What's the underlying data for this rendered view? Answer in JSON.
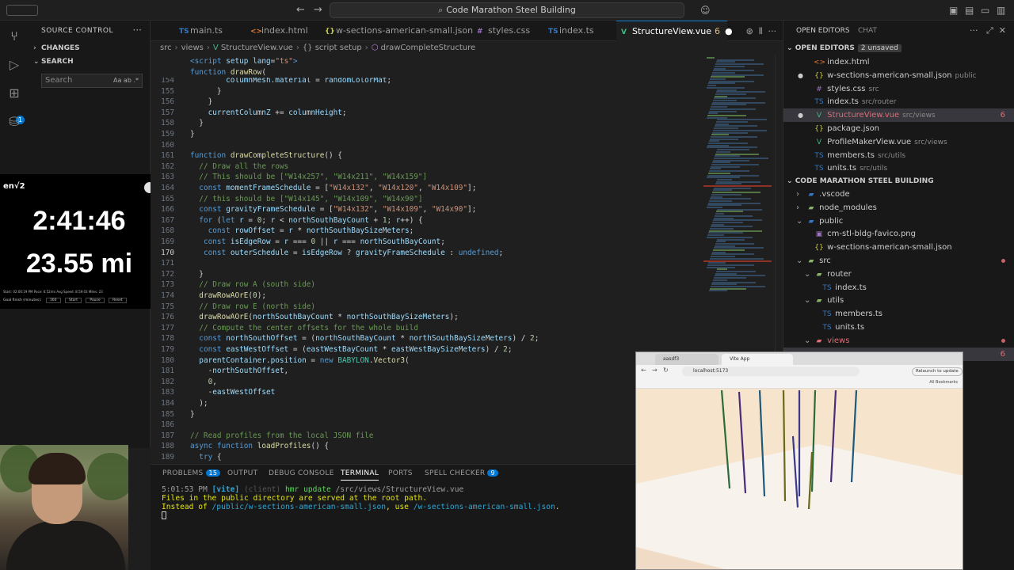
{
  "titlebar": {
    "command_center": "Code Marathon Steel Building"
  },
  "sidebar": {
    "header": "SOURCE CONTROL",
    "changes_label": "CHANGES",
    "search_label": "SEARCH",
    "search_placeholder": "Search",
    "search_opts": "Aa  ab  .*",
    "extensions_badge": "1"
  },
  "overlay": {
    "logo": "en√2",
    "elapsed": "2:41:46",
    "distance": "23.55 mi",
    "stats": "Start: 02:00:19 PM    Pace: 6:52/mi    Avg Speed: 8:59:03    Miles: 23",
    "goal_label": "Goal finish (minutes):",
    "goal_value": "160",
    "goal_buttons": [
      "Start",
      "Pause",
      "Reset"
    ]
  },
  "tabs": [
    {
      "label": "main.ts",
      "icon": "TS",
      "color": "#3178c6"
    },
    {
      "label": "index.html",
      "icon": "<>",
      "color": "#e37933"
    },
    {
      "label": "w-sections-american-small.json",
      "icon": "{}",
      "color": "#cbcb41"
    },
    {
      "label": "styles.css",
      "icon": "#",
      "color": "#a074c4"
    },
    {
      "label": "index.ts",
      "icon": "TS",
      "color": "#3178c6"
    },
    {
      "label": "StructureView.vue",
      "icon": "V",
      "color": "#41b883",
      "problems": "6",
      "active": true
    }
  ],
  "breadcrumb": [
    "src",
    "views",
    "StructureView.vue",
    "{} script setup",
    "drawCompleteStructure"
  ],
  "editor": {
    "sticky": [
      {
        "ln": "",
        "code": "<script setup lang=\"ts\">"
      },
      {
        "ln": "",
        "code": "function drawRow("
      }
    ],
    "lines": [
      {
        "ln": "154",
        "code": "        columnMesh.material = randomColorMat;"
      },
      {
        "ln": "155",
        "code": "      }"
      },
      {
        "ln": "156",
        "code": "    }"
      },
      {
        "ln": "157",
        "code": "    currentColumnZ += columnHeight;"
      },
      {
        "ln": "158",
        "code": "  }"
      },
      {
        "ln": "159",
        "code": "}"
      },
      {
        "ln": "160",
        "code": ""
      },
      {
        "ln": "161",
        "code": "function drawCompleteStructure() {"
      },
      {
        "ln": "162",
        "code": "  // Draw all the rows"
      },
      {
        "ln": "163",
        "code": "  // This should be [\"W14x257\", \"W14x211\", \"W14x159\"]"
      },
      {
        "ln": "164",
        "code": "  const momentFrameSchedule = [\"W14x132\", \"W14x120\", \"W14x109\"];"
      },
      {
        "ln": "165",
        "code": "  // this should be [\"W14x145\", \"W14x109\", \"W14x90\"]"
      },
      {
        "ln": "166",
        "code": "  const gravityFrameSchedule = [\"W14x132\", \"W14x109\", \"W14x90\"];"
      },
      {
        "ln": "167",
        "code": "  for (let r = 0; r < northSouthBayCount + 1; r++) {"
      },
      {
        "ln": "168",
        "code": "    const rowOffset = r * northSouthBaySizeMeters;"
      },
      {
        "ln": "169",
        "code": "   const isEdgeRow = r === 0 || r === northSouthBayCount;"
      },
      {
        "ln": "170",
        "code": "   const outerSchedule = isEdgeRow ? gravityFrameSchedule : undefined;"
      },
      {
        "ln": "171",
        "code": ""
      },
      {
        "ln": "172",
        "code": "  }"
      },
      {
        "ln": "173",
        "code": "  // Draw row A (south side)"
      },
      {
        "ln": "174",
        "code": "  drawRowAOrE(0);"
      },
      {
        "ln": "175",
        "code": "  // Draw row E (north side)"
      },
      {
        "ln": "176",
        "code": "  drawRowAOrE(northSouthBayCount * northSouthBaySizeMeters);"
      },
      {
        "ln": "177",
        "code": "  // Compute the center offsets for the whole build"
      },
      {
        "ln": "178",
        "code": "  const northSouthOffset = (northSouthBayCount * northSouthBaySizeMeters) / 2;"
      },
      {
        "ln": "179",
        "code": "  const eastWestOffset = (eastWestBayCount * eastWestBaySizeMeters) / 2;"
      },
      {
        "ln": "180",
        "code": "  parentContainer.position = new BABYLON.Vector3("
      },
      {
        "ln": "181",
        "code": "    -northSouthOffset,"
      },
      {
        "ln": "182",
        "code": "    0,"
      },
      {
        "ln": "183",
        "code": "    -eastWestOffset"
      },
      {
        "ln": "184",
        "code": "  );"
      },
      {
        "ln": "185",
        "code": "}"
      },
      {
        "ln": "186",
        "code": ""
      },
      {
        "ln": "187",
        "code": "// Read profiles from the local JSON file"
      },
      {
        "ln": "188",
        "code": "async function loadProfiles() {"
      },
      {
        "ln": "189",
        "code": "  try {"
      }
    ]
  },
  "panel": {
    "tabs": [
      {
        "label": "PROBLEMS",
        "badge": "15"
      },
      {
        "label": "OUTPUT"
      },
      {
        "label": "DEBUG CONSOLE"
      },
      {
        "label": "TERMINAL",
        "active": true
      },
      {
        "label": "PORTS"
      },
      {
        "label": "SPELL CHECKER",
        "badge": "9"
      }
    ],
    "terminal": {
      "time": "5:01:53 PM",
      "tag": "[vite]",
      "client": "(client)",
      "msg1": "hmr update",
      "path1": "/src/views/StructureView.vue",
      "line2": "Files in the public directory are served at the root path.",
      "line3_a": "Instead of",
      "line3_b": "/public/w-sections-american-small.json",
      "line3_c": ", use",
      "line3_d": "/w-sections-american-small.json",
      "line3_e": "."
    }
  },
  "explorer": {
    "tab_open_editors": "OPEN EDITORS",
    "tab_chat": "CHAT",
    "open_editors_label": "OPEN EDITORS",
    "unsaved": "2 unsaved",
    "open_editors": [
      {
        "name": "index.html",
        "dim": "",
        "icon": "<>",
        "color": "#e37933"
      },
      {
        "name": "w-sections-american-small.json",
        "dim": "public",
        "icon": "{}",
        "color": "#cbcb41",
        "dirty": true
      },
      {
        "name": "styles.css",
        "dim": "src",
        "icon": "#",
        "color": "#a074c4"
      },
      {
        "name": "index.ts",
        "dim": "src/router",
        "icon": "TS",
        "color": "#3178c6"
      },
      {
        "name": "StructureView.vue",
        "dim": "src/views",
        "icon": "V",
        "color": "#41b883",
        "dirty": true,
        "selected": true,
        "num": "6",
        "red": true
      },
      {
        "name": "package.json",
        "dim": "",
        "icon": "{}",
        "color": "#cbcb41"
      },
      {
        "name": "ProfileMakerView.vue",
        "dim": "src/views",
        "icon": "V",
        "color": "#41b883"
      },
      {
        "name": "members.ts",
        "dim": "src/utils",
        "icon": "TS",
        "color": "#3178c6"
      },
      {
        "name": "units.ts",
        "dim": "src/utils",
        "icon": "TS",
        "color": "#3178c6"
      }
    ],
    "project_label": "CODE MARATHON STEEL BUILDING",
    "tree": [
      {
        "name": ".vscode",
        "depth": 1,
        "type": "folder",
        "color": "#3178c6"
      },
      {
        "name": "node_modules",
        "depth": 1,
        "type": "folder",
        "color": "#89b36b"
      },
      {
        "name": "public",
        "depth": 1,
        "type": "folder-open",
        "color": "#3178c6"
      },
      {
        "name": "cm-stl-bldg-favico.png",
        "depth": 2,
        "type": "file",
        "icon": "▣",
        "color": "#a074c4"
      },
      {
        "name": "w-sections-american-small.json",
        "depth": 2,
        "type": "file",
        "icon": "{}",
        "color": "#cbcb41"
      },
      {
        "name": "src",
        "depth": 1,
        "type": "folder-open",
        "color": "#89b36b",
        "red": true
      },
      {
        "name": "router",
        "depth": 2,
        "type": "folder-open",
        "color": "#89b36b"
      },
      {
        "name": "index.ts",
        "depth": 3,
        "type": "file",
        "icon": "TS",
        "color": "#3178c6"
      },
      {
        "name": "utils",
        "depth": 2,
        "type": "folder-open",
        "color": "#89b36b"
      },
      {
        "name": "members.ts",
        "depth": 3,
        "type": "file",
        "icon": "TS",
        "color": "#3178c6"
      },
      {
        "name": "units.ts",
        "depth": 3,
        "type": "file",
        "icon": "TS",
        "color": "#3178c6"
      },
      {
        "name": "views",
        "depth": 2,
        "type": "folder-open",
        "color": "#e06c75",
        "red": true
      }
    ],
    "num_row_hidden": "6"
  },
  "browser": {
    "tabs": [
      "aasdf3",
      "Vite App"
    ],
    "url": "localhost:5173",
    "relaunch": "Relaunch to update",
    "all_bookmarks": "All Bookmarks"
  }
}
